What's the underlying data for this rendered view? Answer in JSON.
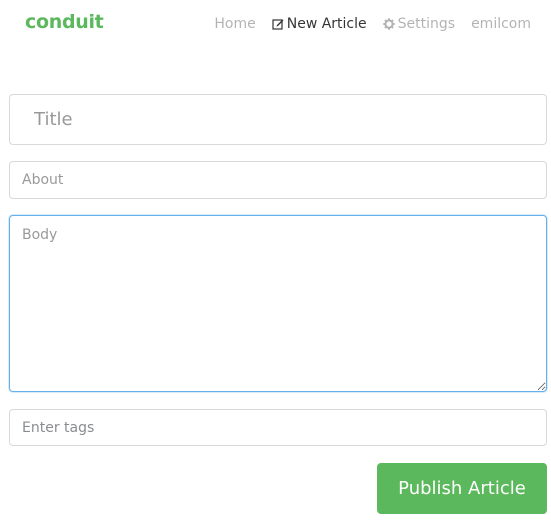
{
  "navbar": {
    "brand": "conduit",
    "items": [
      {
        "label": "Home",
        "icon": null,
        "active": false
      },
      {
        "label": "New Article",
        "icon": "edit-icon",
        "active": true
      },
      {
        "label": "Settings",
        "icon": "gear-icon",
        "active": false
      },
      {
        "label": "emilcom",
        "icon": null,
        "active": false
      }
    ]
  },
  "editor": {
    "title_placeholder": "Title",
    "about_placeholder": "About",
    "body_placeholder": "Body",
    "tags_placeholder": "Enter tags",
    "publish_label": "Publish Article"
  },
  "colors": {
    "brand": "#5cb85c",
    "focus_border": "#66afe9"
  }
}
